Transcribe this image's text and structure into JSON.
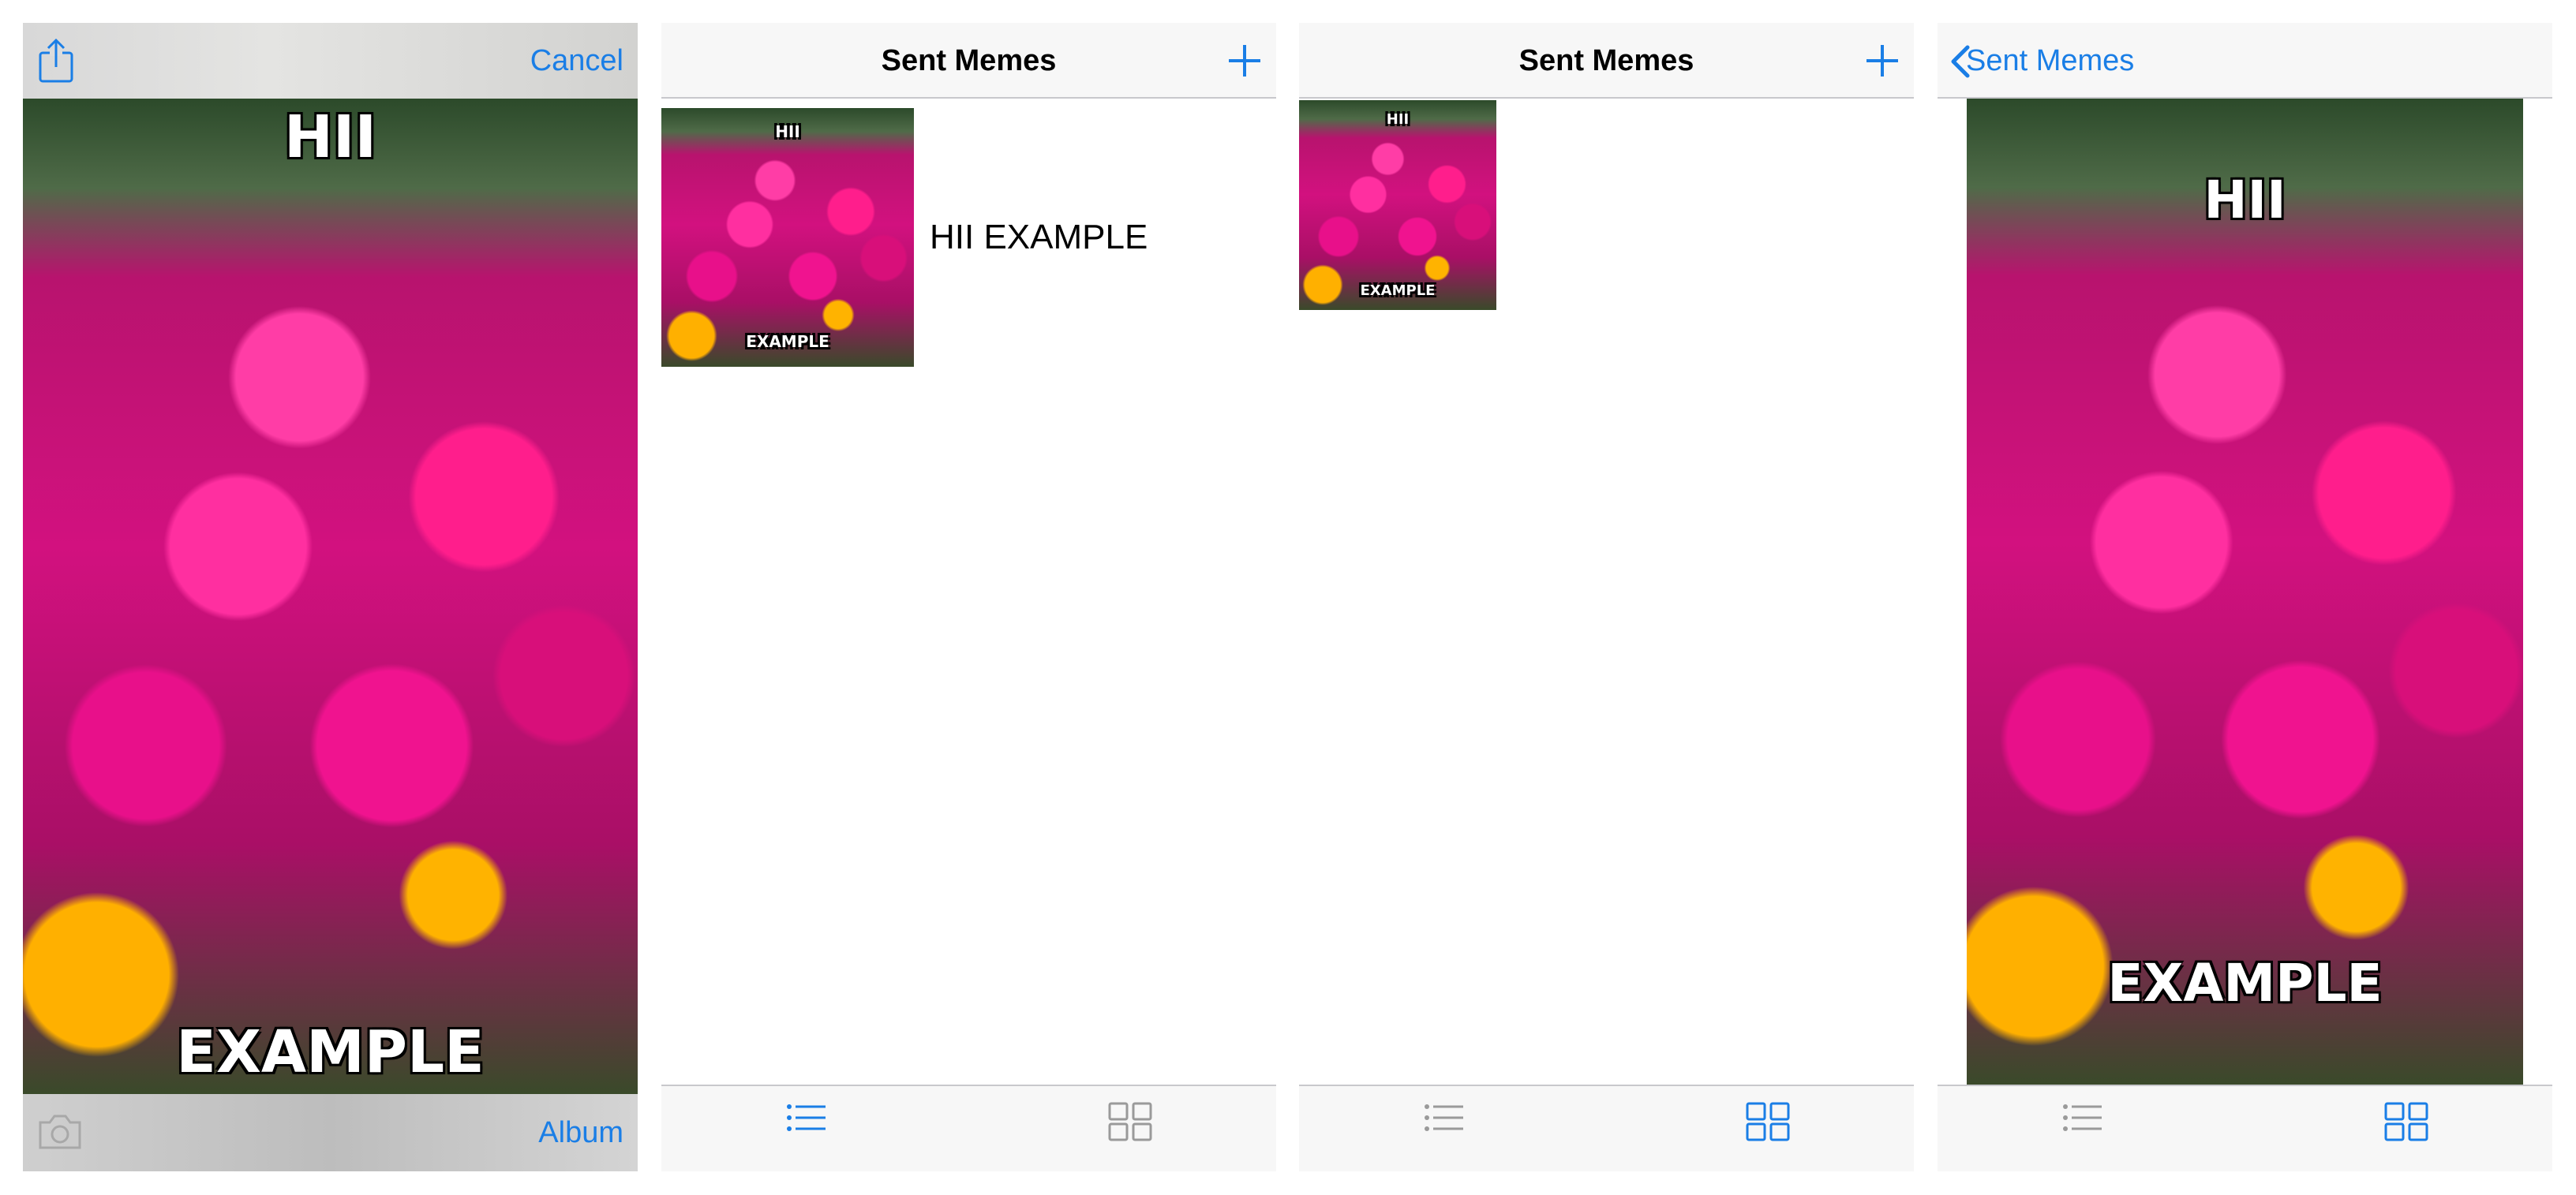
{
  "editor": {
    "cancel_label": "Cancel",
    "album_label": "Album",
    "top_text": "HII",
    "bottom_text": "EXAMPLE",
    "share_icon": "share-icon",
    "camera_icon": "camera-icon"
  },
  "list_view": {
    "title": "Sent Memes",
    "add_icon": "plus-icon",
    "rows": [
      {
        "label": "HII EXAMPLE",
        "top_text": "HII",
        "bottom_text": "EXAMPLE"
      }
    ],
    "tabs": [
      {
        "icon": "list-icon",
        "selected": true
      },
      {
        "icon": "grid-icon",
        "selected": false
      }
    ]
  },
  "grid_view": {
    "title": "Sent Memes",
    "add_icon": "plus-icon",
    "items": [
      {
        "top_text": "HII",
        "bottom_text": "EXAMPLE"
      }
    ],
    "tabs": [
      {
        "icon": "list-icon",
        "selected": false
      },
      {
        "icon": "grid-icon",
        "selected": true
      }
    ]
  },
  "detail_view": {
    "back_label": "Sent Memes",
    "top_text": "HII",
    "bottom_text": "EXAMPLE",
    "tabs": [
      {
        "icon": "list-icon",
        "selected": false
      },
      {
        "icon": "grid-icon",
        "selected": true
      }
    ]
  },
  "colors": {
    "accent": "#1a7ee6",
    "inactive_icon": "#9a9a9a",
    "bar_background": "#f7f7f7"
  }
}
